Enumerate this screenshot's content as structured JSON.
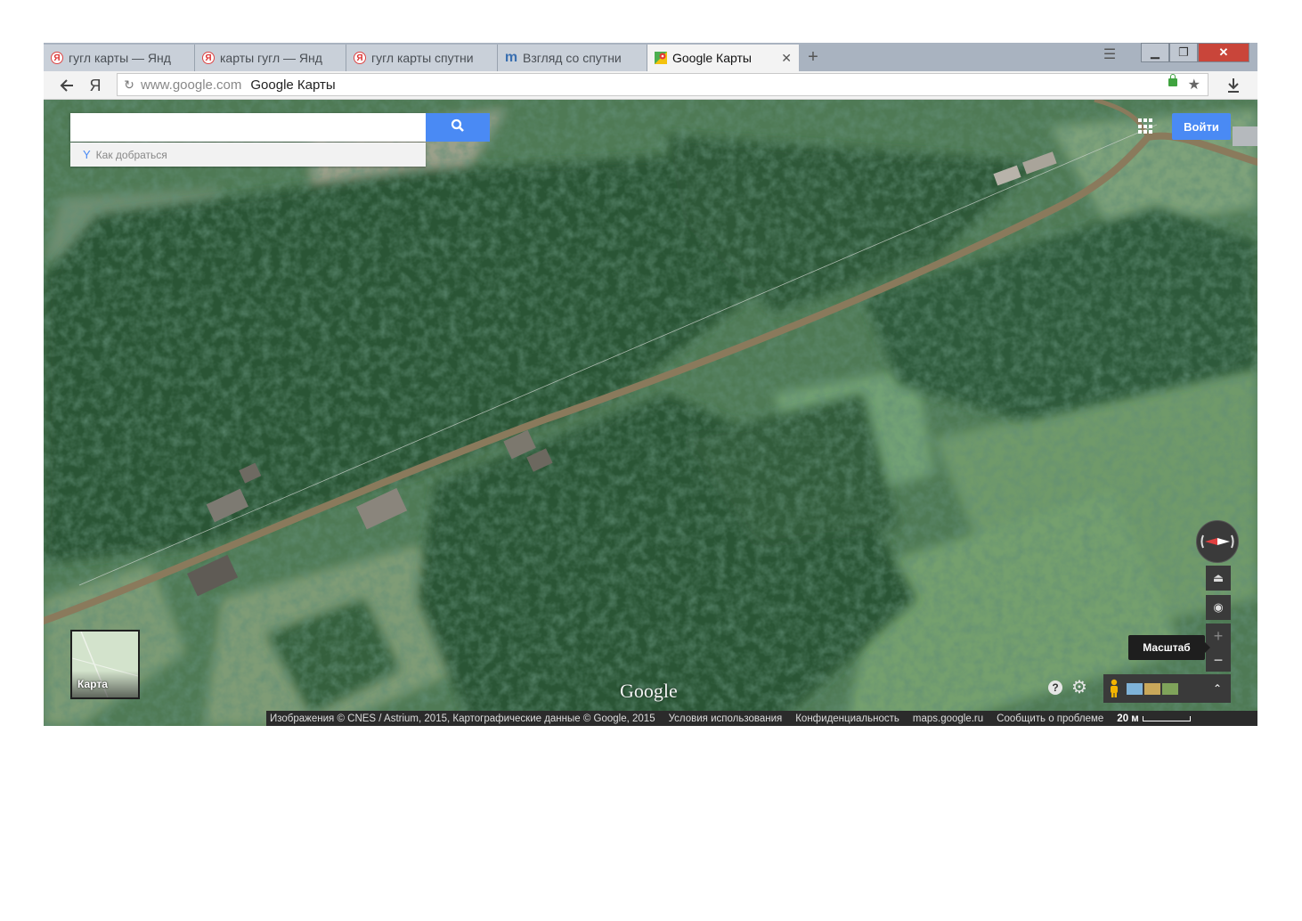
{
  "browser": {
    "tabs": [
      {
        "label": "гугл карты — Янд",
        "icon": "yandex-icon"
      },
      {
        "label": "карты гугл — Янд",
        "icon": "yandex-icon"
      },
      {
        "label": "гугл карты спутни",
        "icon": "yandex-icon"
      },
      {
        "label": "Взгляд со спутни",
        "icon": "mail-m-icon"
      },
      {
        "label": "Google Карты",
        "icon": "google-maps-icon",
        "active": true
      }
    ],
    "yandex_glyph": "Я",
    "url_domain": "www.google.com",
    "page_title": "Google Карты"
  },
  "maps": {
    "search_placeholder": "",
    "directions_label": "Как добраться",
    "signin_label": "Войти",
    "zoom_tooltip": "Масштаб",
    "minimap_label": "Карта",
    "logo_text": "Google",
    "footer": {
      "imagery": "Изображения © CNES / Astrium, 2015, Картографические данные © Google, 2015",
      "terms": "Условия использования",
      "privacy": "Конфиденциальность",
      "site": "maps.google.ru",
      "report": "Сообщить о проблеме",
      "scale": "20 м"
    }
  },
  "colors": {
    "accent": "#4a8af4",
    "tab_strip": "#a9b3c0",
    "close_button": "#c9453a",
    "forest": "#2f5a3a",
    "road": "#8a7a5c"
  }
}
